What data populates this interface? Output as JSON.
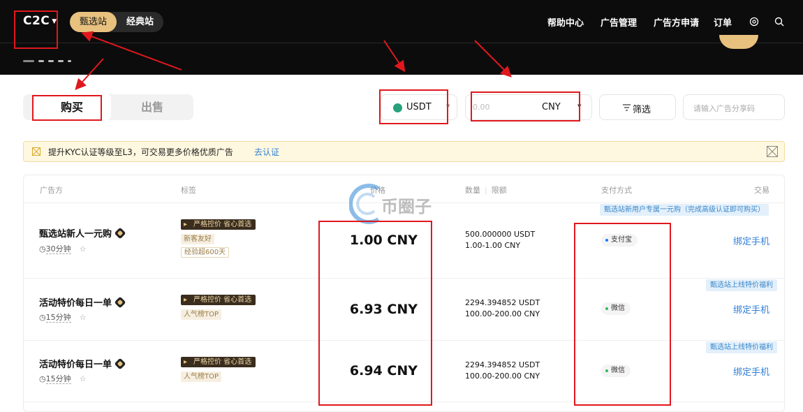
{
  "header": {
    "logo": "C2C",
    "tabs": [
      "甄选站",
      "经典站"
    ],
    "nav": [
      "帮助中心",
      "广告管理",
      "广告方申请",
      "订单"
    ],
    "icons": [
      "settings-icon",
      "search-icon"
    ]
  },
  "toolbar": {
    "buy": "购买",
    "sell": "出售",
    "coin": "USDT",
    "amount_placeholder": "0.00",
    "currency": "CNY",
    "filter": "筛选",
    "share_placeholder": "请输入广告分享码"
  },
  "notice": {
    "text": "提升KYC认证等级至L3，可交易更多价格优质广告",
    "link": "去认证"
  },
  "table": {
    "headers": [
      "广告方",
      "标签",
      "价格",
      "数量",
      "限额",
      "支付方式",
      "交易"
    ],
    "rows": [
      {
        "name": "甄选站新人一元购",
        "time": "30分钟",
        "tags": [
          "严格控价 省心首选",
          "新客友好",
          "经验超600天"
        ],
        "price": "1.00 CNY",
        "qty": "500.000000 USDT",
        "limit": "1.00-1.00 CNY",
        "pay": "支付宝",
        "promo": "甄选站新用户专属一元购（完成高级认证即可购买）",
        "action": "绑定手机"
      },
      {
        "name": "活动特价每日一单",
        "time": "15分钟",
        "tags": [
          "严格控价 省心首选",
          "人气榜TOP"
        ],
        "price": "6.93 CNY",
        "qty": "2294.394852 USDT",
        "limit": "100.00-200.00 CNY",
        "pay": "微信",
        "promo": "甄选站上线特价福利",
        "action": "绑定手机"
      },
      {
        "name": "活动特价每日一单",
        "time": "15分钟",
        "tags": [
          "严格控价 省心首选",
          "人气榜TOP"
        ],
        "price": "6.94 CNY",
        "qty": "2294.394852 USDT",
        "limit": "100.00-200.00 CNY",
        "pay": "微信",
        "promo": "甄选站上线特价福利",
        "action": "绑定手机"
      }
    ]
  },
  "watermark": "币圈子",
  "colors": {
    "accent": "#e8c17f",
    "annotation": "#e0181e",
    "link": "#2f7fd6",
    "alipay": "#1677ff",
    "wechat": "#2dbb5d"
  }
}
